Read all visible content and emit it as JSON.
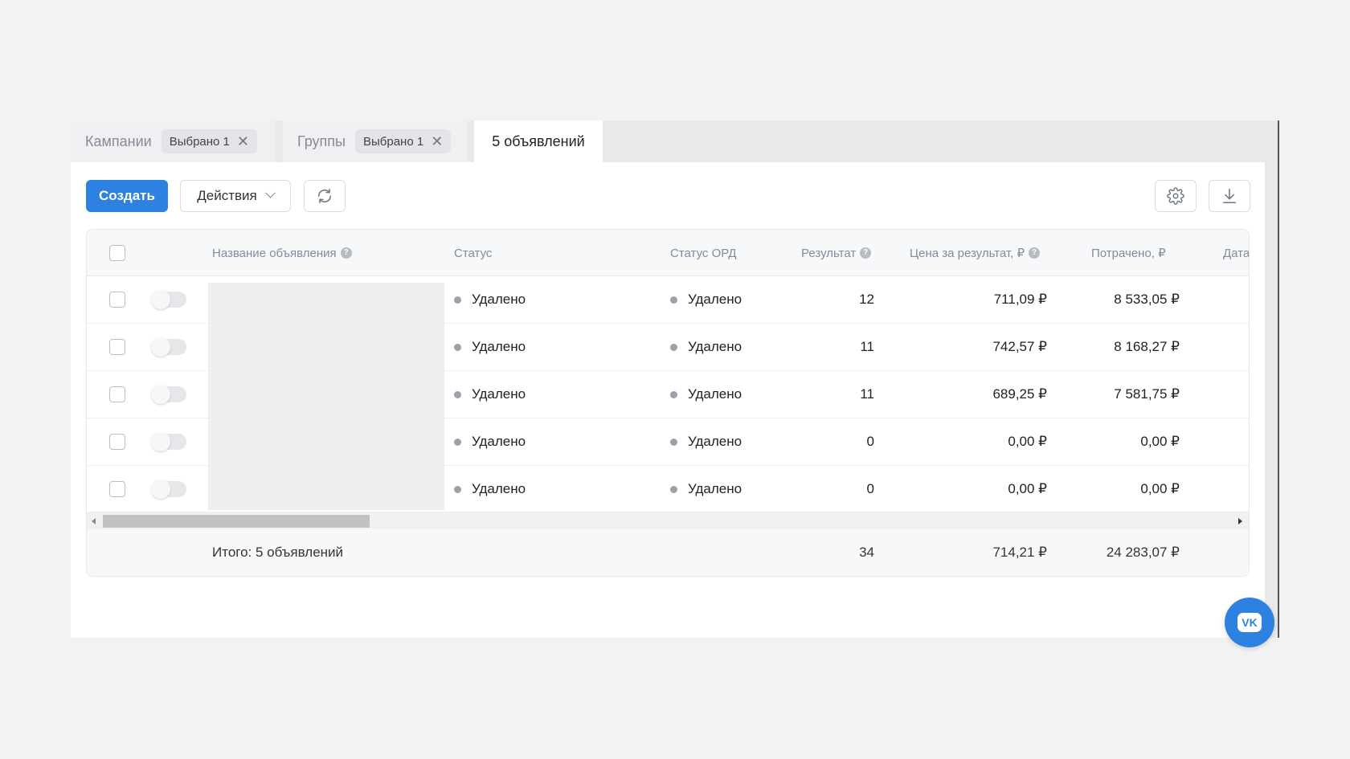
{
  "tabs": {
    "campaigns": {
      "label": "Кампании",
      "chip": "Выбрано 1"
    },
    "groups": {
      "label": "Группы",
      "chip": "Выбрано 1"
    },
    "ads": {
      "label": "5 объявлений"
    }
  },
  "toolbar": {
    "create_label": "Создать",
    "actions_label": "Действия",
    "refresh_icon": "refresh-icon",
    "settings_icon": "gear-icon",
    "download_icon": "download-icon"
  },
  "table": {
    "columns": {
      "name": "Название объявления",
      "status": "Статус",
      "ord_status": "Статус ОРД",
      "result": "Результат",
      "price": "Цена за результат, ₽",
      "spent": "Потрачено, ₽",
      "date": "Дата"
    },
    "rows": [
      {
        "status": "Удалено",
        "ord_status": "Удалено",
        "result": "12",
        "price": "711,09 ₽",
        "spent": "8 533,05 ₽",
        "enabled": false,
        "checked": false
      },
      {
        "status": "Удалено",
        "ord_status": "Удалено",
        "result": "11",
        "price": "742,57 ₽",
        "spent": "8 168,27 ₽",
        "enabled": false,
        "checked": false
      },
      {
        "status": "Удалено",
        "ord_status": "Удалено",
        "result": "11",
        "price": "689,25 ₽",
        "spent": "7 581,75 ₽",
        "enabled": false,
        "checked": false
      },
      {
        "status": "Удалено",
        "ord_status": "Удалено",
        "result": "0",
        "price": "0,00 ₽",
        "spent": "0,00 ₽",
        "enabled": false,
        "checked": false
      },
      {
        "status": "Удалено",
        "ord_status": "Удалено",
        "result": "0",
        "price": "0,00 ₽",
        "spent": "0,00 ₽",
        "enabled": false,
        "checked": false
      }
    ],
    "footer": {
      "label": "Итого: 5 объявлений",
      "result": "34",
      "price": "714,21 ₽",
      "spent": "24 283,07 ₽"
    }
  },
  "fab": {
    "label": "VK",
    "icon": "vk-logo-icon"
  },
  "colors": {
    "primary": "#2d81e0",
    "status_dot": "#9aa1aa"
  }
}
